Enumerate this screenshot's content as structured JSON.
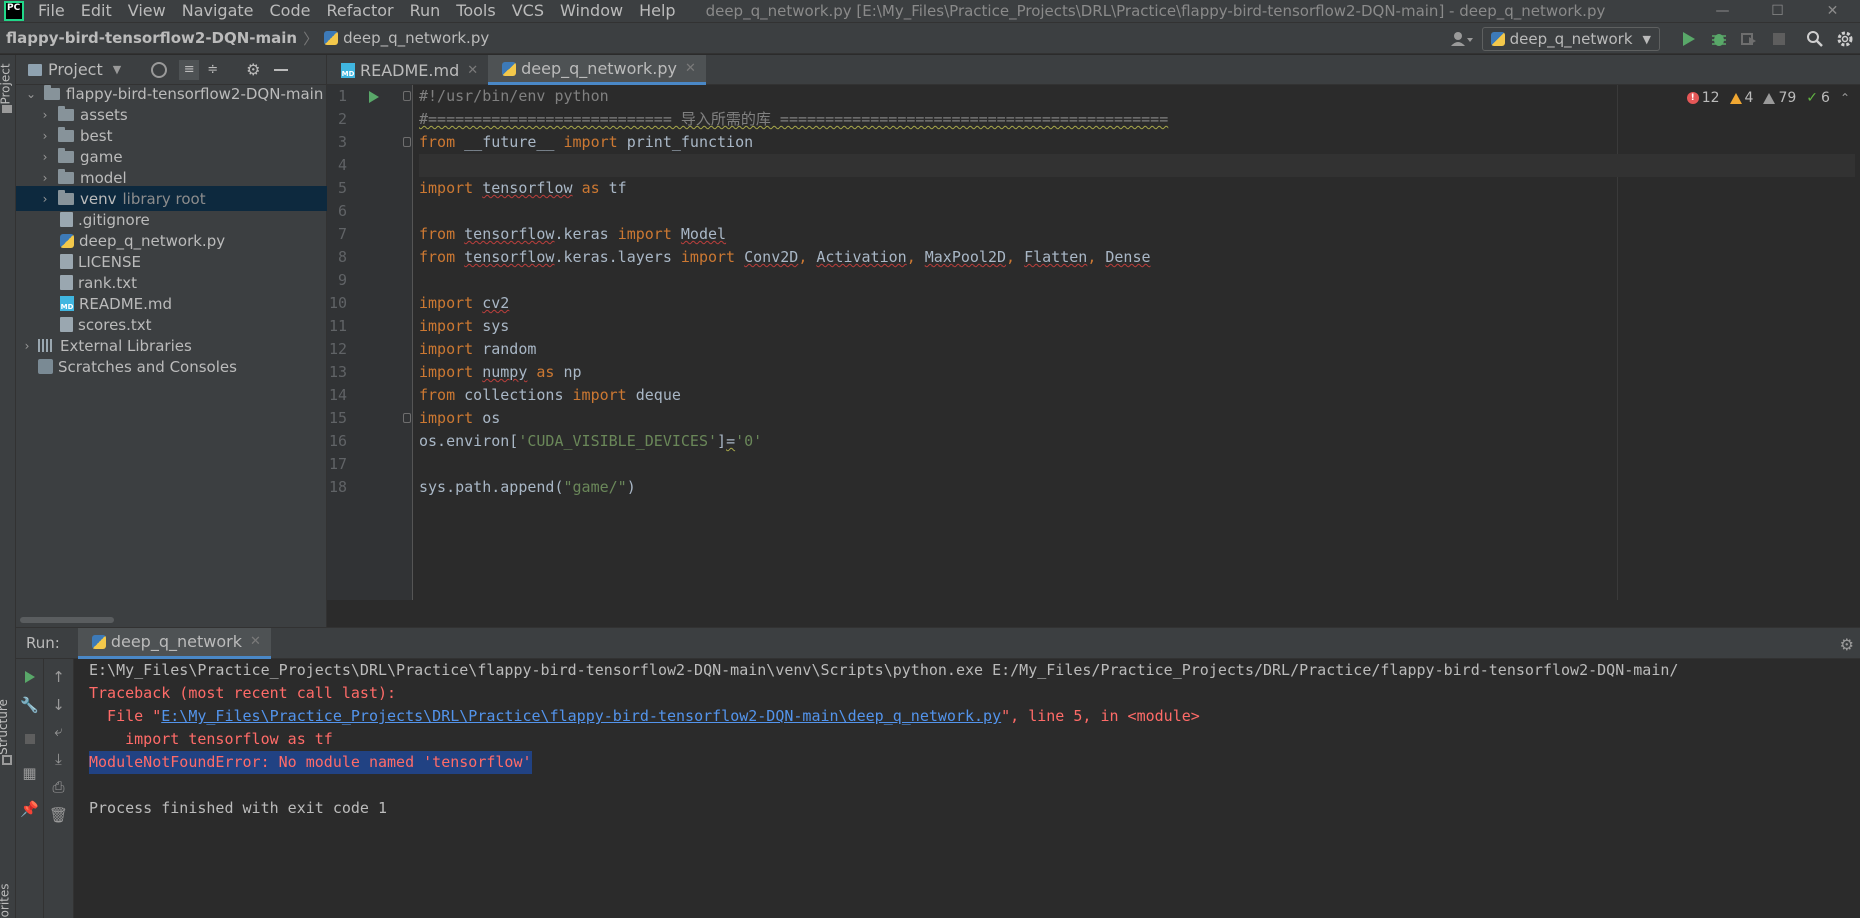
{
  "menubar": {
    "logo_text": "PC",
    "items": [
      "File",
      "Edit",
      "View",
      "Navigate",
      "Code",
      "Refactor",
      "Run",
      "Tools",
      "VCS",
      "Window",
      "Help"
    ],
    "window_title": "deep_q_network.py [E:\\My_Files\\Practice_Projects\\DRL\\Practice\\flappy-bird-tensorflow2-DQN-main] - deep_q_network.py",
    "controls": [
      "—",
      "☐",
      "✕"
    ]
  },
  "navbar": {
    "project": "flappy-bird-tensorflow2-DQN-main",
    "file": "deep_q_network.py",
    "run_config": "deep_q_network"
  },
  "stripe": {
    "project": "Project",
    "structure": "Structure",
    "favorites": "vorites"
  },
  "project_panel": {
    "title": "Project",
    "tree": [
      {
        "label": "flappy-bird-tensorflow2-DQN-main",
        "type": "folder",
        "expanded": true
      },
      {
        "label": "assets",
        "type": "folder"
      },
      {
        "label": "best",
        "type": "folder"
      },
      {
        "label": "game",
        "type": "folder"
      },
      {
        "label": "model",
        "type": "folder"
      },
      {
        "label": "venv",
        "type": "folder",
        "suffix": "library root",
        "selected": true
      },
      {
        "label": ".gitignore",
        "type": "file"
      },
      {
        "label": "deep_q_network.py",
        "type": "py"
      },
      {
        "label": "LICENSE",
        "type": "file"
      },
      {
        "label": "rank.txt",
        "type": "file"
      },
      {
        "label": "README.md",
        "type": "md"
      },
      {
        "label": "scores.txt",
        "type": "file"
      },
      {
        "label": "External Libraries",
        "type": "lib"
      },
      {
        "label": "Scratches and Consoles",
        "type": "scratch"
      }
    ]
  },
  "editor_tabs": [
    {
      "label": "README.md",
      "active": false
    },
    {
      "label": "deep_q_network.py",
      "active": true
    }
  ],
  "inspections": {
    "errors": "12",
    "warnings": "4",
    "weak_warnings": "79",
    "typos": "6"
  },
  "code": {
    "line_numbers": [
      "1",
      "2",
      "3",
      "4",
      "5",
      "6",
      "7",
      "8",
      "9",
      "10",
      "11",
      "12",
      "13",
      "14",
      "15",
      "16",
      "17",
      "18"
    ],
    "l1": "#!/usr/bin/env python",
    "l2": "#=========================== 导入所需的库 ===========================================",
    "l3": {
      "a": "from",
      "b": " __future__ ",
      "c": "import",
      "d": " print_function"
    },
    "l5": {
      "a": "import",
      "b": " ",
      "c": "tensorflow",
      "d": " ",
      "e": "as",
      "f": " tf"
    },
    "l7": {
      "a": "from",
      "b": " ",
      "c": "tensorflow",
      "d": ".keras ",
      "e": "import",
      "f": " ",
      "g": "Model"
    },
    "l8": {
      "a": "from",
      "b": " ",
      "c": "tensorflow",
      "d": ".keras.layers ",
      "e": "import",
      "f": " ",
      "g": "Conv2D",
      "h": ", ",
      "i": "Activation",
      "j": ", ",
      "k": "MaxPool2D",
      "l": ", ",
      "m": "Flatten",
      "n": ", ",
      "o": "Dense"
    },
    "l10": {
      "a": "import",
      "b": " ",
      "c": "cv2"
    },
    "l11": {
      "a": "import",
      "b": " sys"
    },
    "l12": {
      "a": "import",
      "b": " random"
    },
    "l13": {
      "a": "import",
      "b": " ",
      "c": "numpy",
      "d": " ",
      "e": "as",
      "f": " np"
    },
    "l14": {
      "a": "from",
      "b": " collections ",
      "c": "import",
      "d": " deque"
    },
    "l15": {
      "a": "import",
      "b": " os"
    },
    "l16": {
      "a": "os.environ[",
      "b": "'CUDA_VISIBLE_DEVICES'",
      "c": "]",
      "d": "=",
      "e": "'0'"
    },
    "l18": {
      "a": "sys.path.append(",
      "b": "\"game/\"",
      "c": ")"
    }
  },
  "run_panel": {
    "label": "Run:",
    "tab": "deep_q_network",
    "console": {
      "cmd": "E:\\My_Files\\Practice_Projects\\DRL\\Practice\\flappy-bird-tensorflow2-DQN-main\\venv\\Scripts\\python.exe E:/My_Files/Practice_Projects/DRL/Practice/flappy-bird-tensorflow2-DQN-main/",
      "traceback": "Traceback (most recent call last):",
      "file_prefix": "  File \"",
      "file_link": "E:\\My_Files\\Practice_Projects\\DRL\\Practice\\flappy-bird-tensorflow2-DQN-main\\deep_q_network.py",
      "file_suffix": "\", line 5, in <module>",
      "code_line": "    import tensorflow as tf",
      "error": "ModuleNotFoundError: No module named 'tensorflow'",
      "exit": "Process finished with exit code 1"
    }
  },
  "colors": {
    "keyword": "#cc7832",
    "string": "#6a8759",
    "comment": "#808080",
    "error_text": "#ff6b68",
    "link": "#5394ec",
    "selection": "#214283"
  }
}
